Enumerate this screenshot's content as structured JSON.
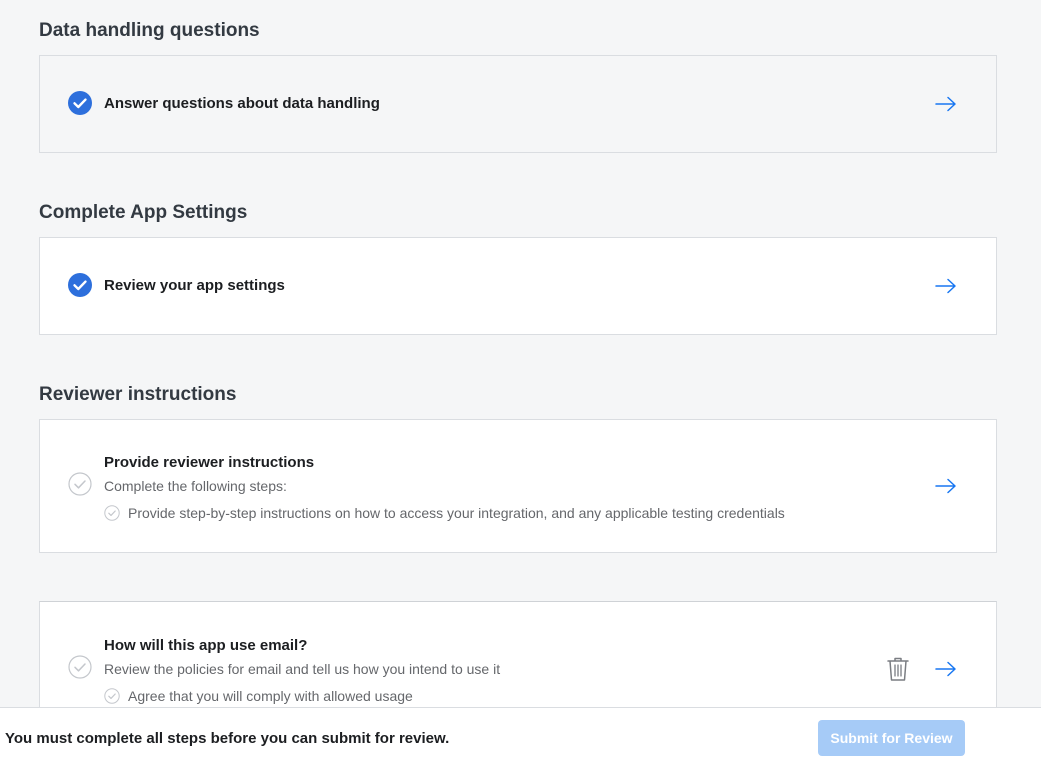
{
  "sections": {
    "data_handling": {
      "title": "Data handling questions",
      "task": {
        "title": "Answer questions about data handling",
        "status_icon": "check-filled-icon"
      }
    },
    "app_settings": {
      "title": "Complete App Settings",
      "task": {
        "title": "Review your app settings",
        "status_icon": "check-filled-icon"
      }
    },
    "reviewer_instructions": {
      "title": "Reviewer instructions",
      "task": {
        "title": "Provide reviewer instructions",
        "description": "Complete the following steps:",
        "steps": [
          "Provide step-by-step instructions on how to access your integration, and any applicable testing credentials"
        ],
        "status_icon": "check-outline-icon"
      }
    },
    "email_usage": {
      "task": {
        "title": "How will this app use email?",
        "description": "Review the policies for email and tell us how you intend to use it",
        "steps": [
          "Agree that you will comply with allowed usage"
        ],
        "status_icon": "check-outline-icon"
      }
    }
  },
  "footer": {
    "message": "You must complete all steps before you can submit for review.",
    "submit_label": "Submit for Review"
  },
  "colors": {
    "accent": "#1877f2",
    "check_filled": "#2d6fdc",
    "submit_disabled": "#a6cbf7"
  }
}
